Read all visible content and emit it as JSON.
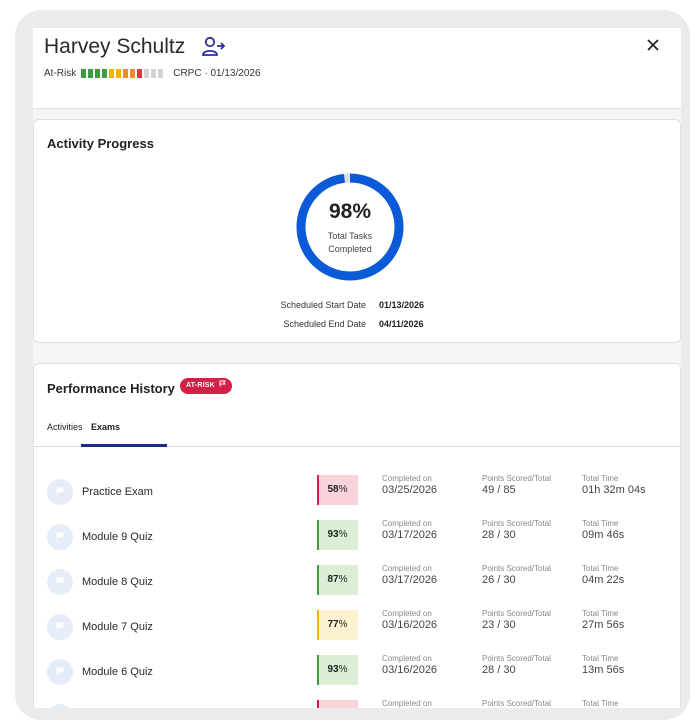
{
  "header": {
    "name": "Harvey Schultz",
    "risk_label": "At-Risk",
    "risk_segments": [
      "#3f9d3f",
      "#3f9d3f",
      "#3f9d3f",
      "#3f9d3f",
      "#f2b300",
      "#f2b300",
      "#ef8a2d",
      "#ef8a2d",
      "#d93b3b",
      "#d3d3d3",
      "#d3d3d3",
      "#d3d3d3"
    ],
    "meta": "CRPC · 01/13/2026",
    "close_icon": "close-icon",
    "user_action_icon": "user-arrow-icon"
  },
  "activity": {
    "title": "Activity Progress",
    "percent": 98,
    "percent_text": "98%",
    "label": "Total Tasks Completed",
    "start_label": "Scheduled Start Date",
    "start_value": "01/13/2026",
    "end_label": "Scheduled End Date",
    "end_value": "04/11/2026",
    "ring_color": "#0b5ad8",
    "ring_track_color": "#dcdfe6"
  },
  "performance": {
    "title": "Performance History",
    "badge": "AT-RISK",
    "badge_color": "#d32047",
    "tabs": [
      {
        "label": "Activities",
        "active": false
      },
      {
        "label": "Exams",
        "active": true
      }
    ],
    "col_labels": {
      "completed": "Completed on",
      "points": "Points Scored/Total",
      "time": "Total Time"
    },
    "rows": [
      {
        "name": "Practice Exam",
        "score_num": "58",
        "score_pct": "%",
        "completed": "03/25/2026",
        "points": "49 / 85",
        "time": "01h 32m 04s",
        "status": "fail"
      },
      {
        "name": "Module 9 Quiz",
        "score_num": "93",
        "score_pct": "%",
        "completed": "03/17/2026",
        "points": "28 / 30",
        "time": "09m 46s",
        "status": "pass"
      },
      {
        "name": "Module 8 Quiz",
        "score_num": "87",
        "score_pct": "%",
        "completed": "03/17/2026",
        "points": "26 / 30",
        "time": "04m 22s",
        "status": "pass"
      },
      {
        "name": "Module 7 Quiz",
        "score_num": "77",
        "score_pct": "%",
        "completed": "03/16/2026",
        "points": "23 / 30",
        "time": "27m 56s",
        "status": "warn"
      },
      {
        "name": "Module 6 Quiz",
        "score_num": "93",
        "score_pct": "%",
        "completed": "03/16/2026",
        "points": "28 / 30",
        "time": "13m 56s",
        "status": "pass"
      },
      {
        "name": "",
        "score_num": "",
        "score_pct": "",
        "completed": "",
        "points": "",
        "time": "",
        "status": "fail"
      }
    ],
    "status_colors": {
      "fail": {
        "bg": "#f8d3da",
        "bar": "#d32047"
      },
      "pass": {
        "bg": "#dcefd5",
        "bar": "#3f9d3f"
      },
      "warn": {
        "bg": "#fdf2cf",
        "bar": "#f2b300"
      }
    },
    "row_icon": "flag-icon"
  }
}
